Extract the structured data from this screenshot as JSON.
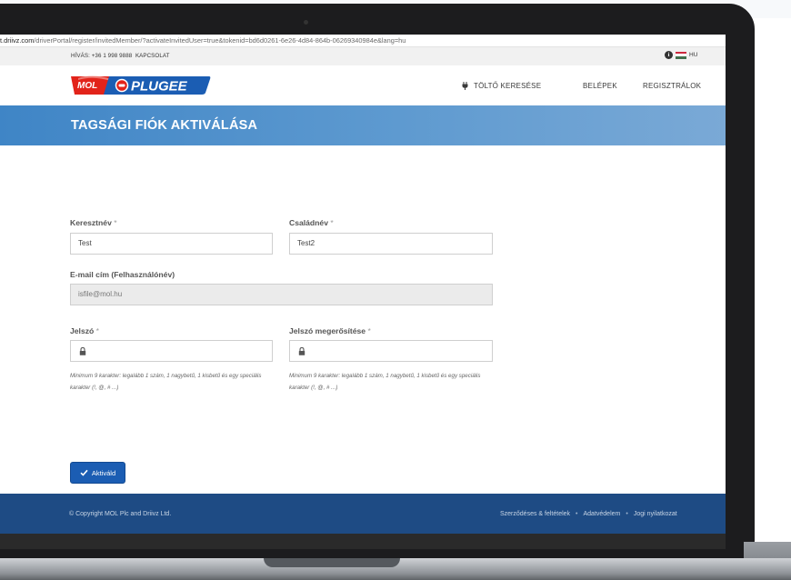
{
  "browser": {
    "url_host": "t.driivz.com",
    "url_path": "/driverPortal/register/invitedMember/?activateInvitedUser=true&tokenid=bd6d0261-6e26-4d84-864b-06269340984e&lang=hu"
  },
  "topbar": {
    "call_text": "HÍVÁS: +36 1 998 9888",
    "contact_label": "KAPCSOLAT",
    "language": "HU"
  },
  "logo": {
    "mol_text": "MOL",
    "plugee_text": "PLUGEE"
  },
  "nav": {
    "find_charger": "TÖLTŐ KERESÉSE",
    "login": "BELÉPEK",
    "register": "REGISZTRÁLOK"
  },
  "banner": {
    "title": "TAGSÁGI FIÓK AKTIVÁLÁSA"
  },
  "form": {
    "first_name": {
      "label": "Keresztnév",
      "required": "*",
      "value": "Test"
    },
    "last_name": {
      "label": "Családnév",
      "required": "*",
      "value": "Test2"
    },
    "email": {
      "label": "E-mail cím (Felhasználónév)",
      "value": "isfile@mol.hu"
    },
    "password": {
      "label": "Jelszó",
      "required": "*",
      "value": ""
    },
    "password_confirm": {
      "label": "Jelszó megerősítése",
      "required": "*",
      "value": ""
    },
    "password_hint": "Minimum 9 karakter: legalább 1 szám, 1 nagybetű, 1 kisbetű és egy speciális karakter (!, @, # ...)",
    "password_confirm_hint": "Minimum 9 karakter: legalább 1 szám, 1 nagybetű, 1 kisbetű és egy speciális karakter (!, @, # ...)",
    "submit_label": "Aktiváld"
  },
  "footer": {
    "copyright": "© Copyright MOL Plc and Driivz Ltd.",
    "links": [
      "Szerződéses & feltételek",
      "Adatvédelem",
      "Jogi nyilatkozat"
    ],
    "separator": "•"
  },
  "colors": {
    "brand_blue": "#1b5db3",
    "banner_blue": "#3f85c6",
    "footer_blue": "#1e4b84",
    "mol_red": "#e2231a"
  }
}
